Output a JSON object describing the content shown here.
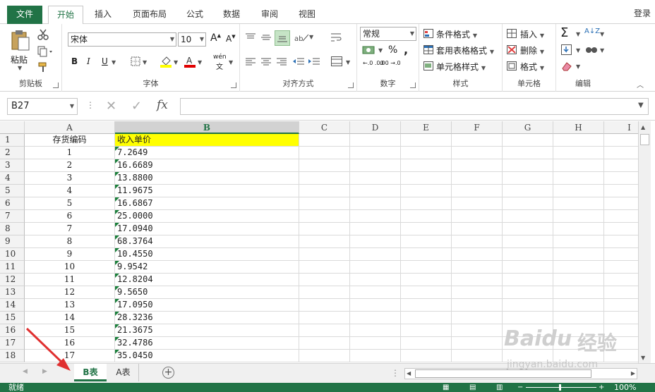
{
  "tabs": {
    "file": "文件",
    "items": [
      "开始",
      "插入",
      "页面布局",
      "公式",
      "数据",
      "审阅",
      "视图"
    ],
    "login": "登录"
  },
  "clipboard": {
    "paste": "粘贴",
    "label": "剪贴板"
  },
  "font": {
    "name": "宋体",
    "size": "10",
    "label": "字体",
    "bold": "B",
    "italic": "I",
    "underline": "U",
    "grow": "A",
    "shrink": "A",
    "phonetic": "wén"
  },
  "alignment": {
    "label": "对齐方式"
  },
  "number": {
    "format": "常规",
    "percent": "%",
    "comma": ",",
    "label": "数字",
    "inc": "←.0 .00",
    "dec": ".00 →.0"
  },
  "styles": {
    "conditional": "条件格式",
    "table": "套用表格格式",
    "cell": "单元格样式",
    "label": "样式"
  },
  "cells": {
    "insert": "插入",
    "delete": "删除",
    "format": "格式",
    "label": "单元格"
  },
  "editing": {
    "label": "编辑",
    "sigma": "Σ",
    "sort": "A↓Z"
  },
  "formula_bar": {
    "name_box": "B27",
    "fx": "fx",
    "cancel": "✕",
    "enter": "✓",
    "value": ""
  },
  "columns": [
    "A",
    "B",
    "C",
    "D",
    "E",
    "F",
    "G",
    "H",
    "I"
  ],
  "header_row": {
    "a": "存货编码",
    "b": "收入单价"
  },
  "rows": [
    {
      "n": "2",
      "a": "1",
      "b": "7.2649"
    },
    {
      "n": "3",
      "a": "2",
      "b": "16.6689"
    },
    {
      "n": "4",
      "a": "3",
      "b": "13.8800"
    },
    {
      "n": "5",
      "a": "4",
      "b": "11.9675"
    },
    {
      "n": "6",
      "a": "5",
      "b": "16.6867"
    },
    {
      "n": "7",
      "a": "6",
      "b": "25.0000"
    },
    {
      "n": "8",
      "a": "7",
      "b": "17.0940"
    },
    {
      "n": "9",
      "a": "8",
      "b": "68.3764"
    },
    {
      "n": "10",
      "a": "9",
      "b": "10.4550"
    },
    {
      "n": "11",
      "a": "10",
      "b": "9.9542"
    },
    {
      "n": "12",
      "a": "11",
      "b": "12.8204"
    },
    {
      "n": "13",
      "a": "12",
      "b": "9.5650"
    },
    {
      "n": "14",
      "a": "13",
      "b": "17.0950"
    },
    {
      "n": "15",
      "a": "14",
      "b": "28.3236"
    },
    {
      "n": "16",
      "a": "15",
      "b": "21.3675"
    },
    {
      "n": "17",
      "a": "16",
      "b": "32.4786"
    },
    {
      "n": "18",
      "a": "17",
      "b": "35.0450"
    }
  ],
  "row1_label": "1",
  "sheets": {
    "active": "B表",
    "other": "A表",
    "add": "+"
  },
  "status": {
    "ready": "就绪",
    "zoom": "100%"
  },
  "watermark": {
    "brand": "Baidu",
    "cn": "经验",
    "url": "jingyan.baidu.com"
  },
  "colors": {
    "accent": "#217346",
    "highlight": "#ffff00",
    "arrow": "#e03030"
  }
}
